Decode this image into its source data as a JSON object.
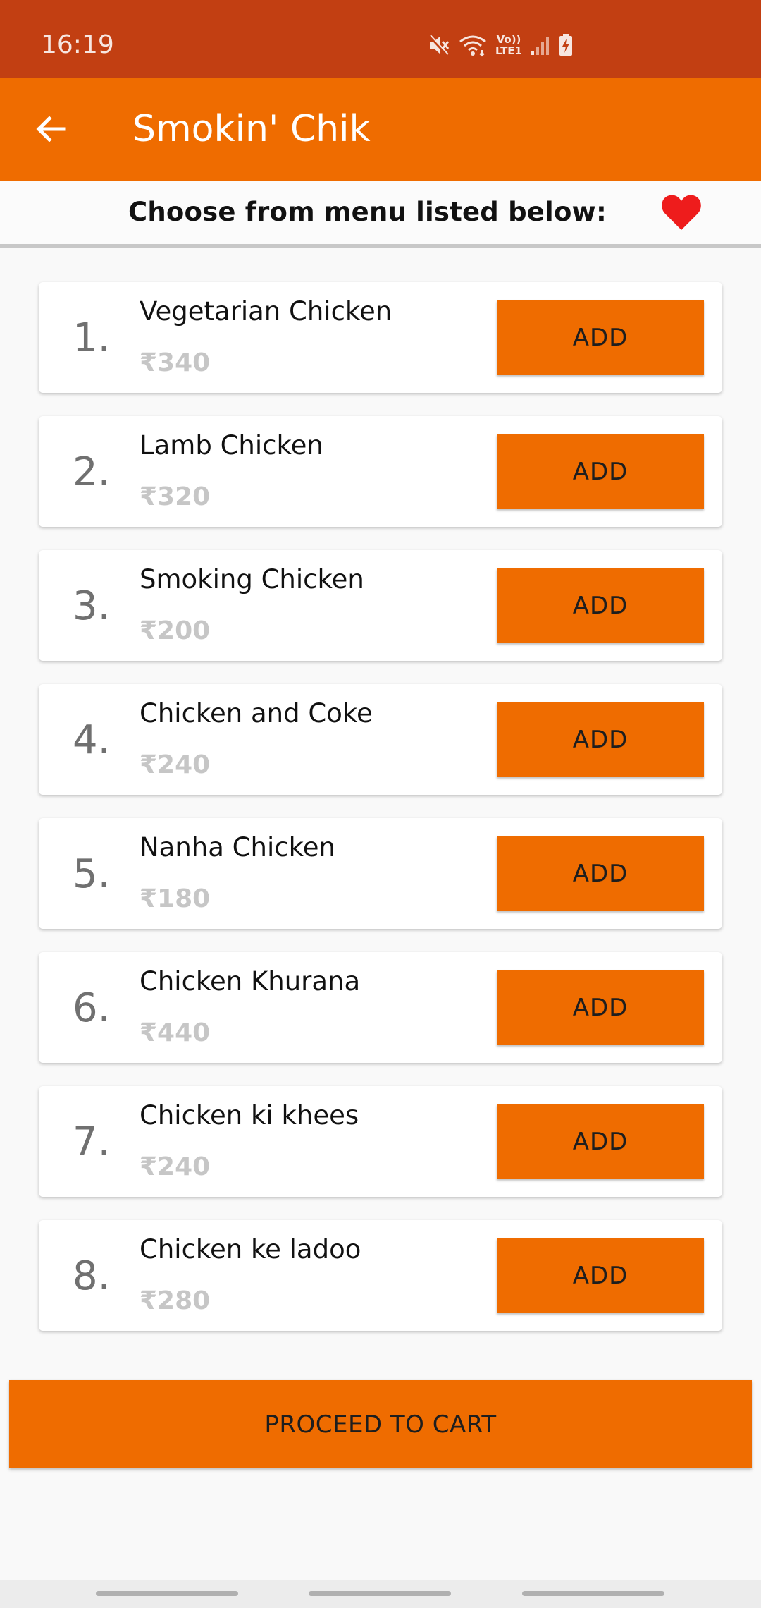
{
  "status_bar": {
    "time": "16:19",
    "network_label": "Vo)) LTE1",
    "icons": [
      "mute-icon",
      "wifi-icon",
      "signal-icon",
      "battery-charging-icon"
    ]
  },
  "app_bar": {
    "title": "Smokin' Chik",
    "back_icon": "arrow-left-icon"
  },
  "subheader": {
    "text": "Choose from menu listed below:",
    "favorite_icon": "heart-icon",
    "favorite_color": "#ee1c1c"
  },
  "menu": {
    "items": [
      {
        "index": "1.",
        "name": "Vegetarian Chicken",
        "price": "₹340",
        "button": "ADD"
      },
      {
        "index": "2.",
        "name": "Lamb Chicken",
        "price": "₹320",
        "button": "ADD"
      },
      {
        "index": "3.",
        "name": "Smoking Chicken",
        "price": "₹200",
        "button": "ADD"
      },
      {
        "index": "4.",
        "name": "Chicken and Coke",
        "price": "₹240",
        "button": "ADD"
      },
      {
        "index": "5.",
        "name": "Nanha Chicken",
        "price": "₹180",
        "button": "ADD"
      },
      {
        "index": "6.",
        "name": "Chicken Khurana",
        "price": "₹440",
        "button": "ADD"
      },
      {
        "index": "7.",
        "name": "Chicken ki khees",
        "price": "₹240",
        "button": "ADD"
      },
      {
        "index": "8.",
        "name": "Chicken ke ladoo",
        "price": "₹280",
        "button": "ADD"
      }
    ]
  },
  "footer": {
    "proceed_label": "PROCEED TO CART"
  },
  "colors": {
    "status_bar": "#c23f12",
    "accent": "#ef6c00",
    "price_text": "#c6c6c6"
  }
}
